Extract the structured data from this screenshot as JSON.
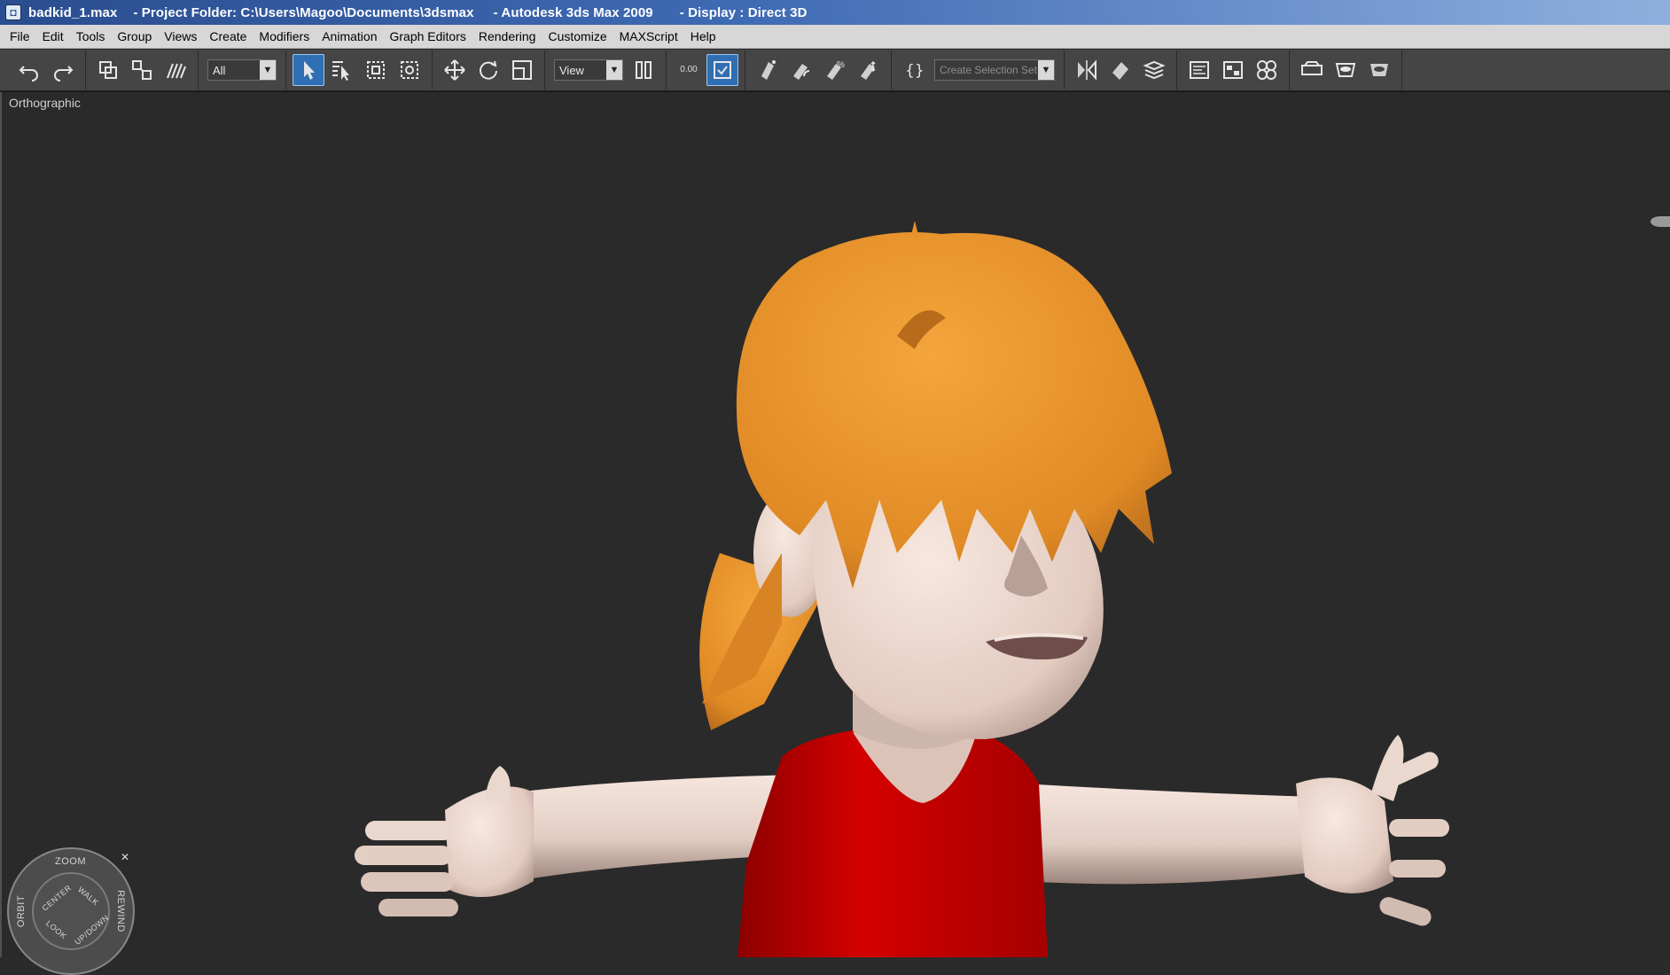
{
  "titlebar": {
    "file": "badkid_1.max",
    "project": "- Project Folder: C:\\Users\\Magoo\\Documents\\3dsmax",
    "app": "- Autodesk 3ds Max  2009",
    "display": "- Display : Direct 3D"
  },
  "menu": [
    "File",
    "Edit",
    "Tools",
    "Group",
    "Views",
    "Create",
    "Modifiers",
    "Animation",
    "Graph Editors",
    "Rendering",
    "Customize",
    "MAXScript",
    "Help"
  ],
  "toolbar": {
    "selection_filter": "All",
    "reference_coord": "View",
    "spinner_value": "0.00",
    "named_selection_placeholder": "Create Selection Set",
    "active_tool": "select-object"
  },
  "viewport": {
    "label": "Orthographic"
  },
  "nav_wheel": {
    "top": "ZOOM",
    "left": "ORBIT",
    "right": "REWIND",
    "center": "CENTER",
    "walk": "WALK",
    "look": "LOOK",
    "updown": "UP/DOWN"
  },
  "colors": {
    "hair": "#e8902b",
    "skin": "#e8d5cc",
    "shirt": "#c80000",
    "viewport_bg": "#2a2a2a"
  }
}
